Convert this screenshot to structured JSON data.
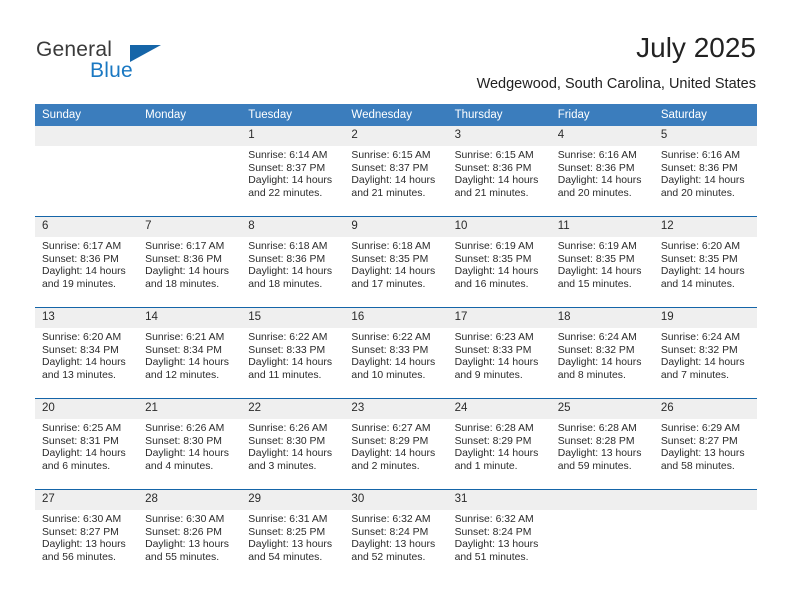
{
  "logo": {
    "word_one": "General",
    "word_two": "Blue",
    "triangle_icon": "triangle-icon",
    "accent_color": "#1a78c2"
  },
  "header": {
    "title": "July 2025",
    "location": "Wedgewood, South Carolina, United States"
  },
  "calendar": {
    "header_bg": "#3b7dbd",
    "separator_color": "#1565a8",
    "daynum_bg": "#efefef",
    "weekday_headers": [
      "Sunday",
      "Monday",
      "Tuesday",
      "Wednesday",
      "Thursday",
      "Friday",
      "Saturday"
    ],
    "weeks": [
      [
        {
          "day": "",
          "sunrise": "",
          "sunset": "",
          "daylight_line1": "",
          "daylight_line2": ""
        },
        {
          "day": "",
          "sunrise": "",
          "sunset": "",
          "daylight_line1": "",
          "daylight_line2": ""
        },
        {
          "day": "1",
          "sunrise": "Sunrise: 6:14 AM",
          "sunset": "Sunset: 8:37 PM",
          "daylight_line1": "Daylight: 14 hours",
          "daylight_line2": "and 22 minutes."
        },
        {
          "day": "2",
          "sunrise": "Sunrise: 6:15 AM",
          "sunset": "Sunset: 8:37 PM",
          "daylight_line1": "Daylight: 14 hours",
          "daylight_line2": "and 21 minutes."
        },
        {
          "day": "3",
          "sunrise": "Sunrise: 6:15 AM",
          "sunset": "Sunset: 8:36 PM",
          "daylight_line1": "Daylight: 14 hours",
          "daylight_line2": "and 21 minutes."
        },
        {
          "day": "4",
          "sunrise": "Sunrise: 6:16 AM",
          "sunset": "Sunset: 8:36 PM",
          "daylight_line1": "Daylight: 14 hours",
          "daylight_line2": "and 20 minutes."
        },
        {
          "day": "5",
          "sunrise": "Sunrise: 6:16 AM",
          "sunset": "Sunset: 8:36 PM",
          "daylight_line1": "Daylight: 14 hours",
          "daylight_line2": "and 20 minutes."
        }
      ],
      [
        {
          "day": "6",
          "sunrise": "Sunrise: 6:17 AM",
          "sunset": "Sunset: 8:36 PM",
          "daylight_line1": "Daylight: 14 hours",
          "daylight_line2": "and 19 minutes."
        },
        {
          "day": "7",
          "sunrise": "Sunrise: 6:17 AM",
          "sunset": "Sunset: 8:36 PM",
          "daylight_line1": "Daylight: 14 hours",
          "daylight_line2": "and 18 minutes."
        },
        {
          "day": "8",
          "sunrise": "Sunrise: 6:18 AM",
          "sunset": "Sunset: 8:36 PM",
          "daylight_line1": "Daylight: 14 hours",
          "daylight_line2": "and 18 minutes."
        },
        {
          "day": "9",
          "sunrise": "Sunrise: 6:18 AM",
          "sunset": "Sunset: 8:35 PM",
          "daylight_line1": "Daylight: 14 hours",
          "daylight_line2": "and 17 minutes."
        },
        {
          "day": "10",
          "sunrise": "Sunrise: 6:19 AM",
          "sunset": "Sunset: 8:35 PM",
          "daylight_line1": "Daylight: 14 hours",
          "daylight_line2": "and 16 minutes."
        },
        {
          "day": "11",
          "sunrise": "Sunrise: 6:19 AM",
          "sunset": "Sunset: 8:35 PM",
          "daylight_line1": "Daylight: 14 hours",
          "daylight_line2": "and 15 minutes."
        },
        {
          "day": "12",
          "sunrise": "Sunrise: 6:20 AM",
          "sunset": "Sunset: 8:35 PM",
          "daylight_line1": "Daylight: 14 hours",
          "daylight_line2": "and 14 minutes."
        }
      ],
      [
        {
          "day": "13",
          "sunrise": "Sunrise: 6:20 AM",
          "sunset": "Sunset: 8:34 PM",
          "daylight_line1": "Daylight: 14 hours",
          "daylight_line2": "and 13 minutes."
        },
        {
          "day": "14",
          "sunrise": "Sunrise: 6:21 AM",
          "sunset": "Sunset: 8:34 PM",
          "daylight_line1": "Daylight: 14 hours",
          "daylight_line2": "and 12 minutes."
        },
        {
          "day": "15",
          "sunrise": "Sunrise: 6:22 AM",
          "sunset": "Sunset: 8:33 PM",
          "daylight_line1": "Daylight: 14 hours",
          "daylight_line2": "and 11 minutes."
        },
        {
          "day": "16",
          "sunrise": "Sunrise: 6:22 AM",
          "sunset": "Sunset: 8:33 PM",
          "daylight_line1": "Daylight: 14 hours",
          "daylight_line2": "and 10 minutes."
        },
        {
          "day": "17",
          "sunrise": "Sunrise: 6:23 AM",
          "sunset": "Sunset: 8:33 PM",
          "daylight_line1": "Daylight: 14 hours",
          "daylight_line2": "and 9 minutes."
        },
        {
          "day": "18",
          "sunrise": "Sunrise: 6:24 AM",
          "sunset": "Sunset: 8:32 PM",
          "daylight_line1": "Daylight: 14 hours",
          "daylight_line2": "and 8 minutes."
        },
        {
          "day": "19",
          "sunrise": "Sunrise: 6:24 AM",
          "sunset": "Sunset: 8:32 PM",
          "daylight_line1": "Daylight: 14 hours",
          "daylight_line2": "and 7 minutes."
        }
      ],
      [
        {
          "day": "20",
          "sunrise": "Sunrise: 6:25 AM",
          "sunset": "Sunset: 8:31 PM",
          "daylight_line1": "Daylight: 14 hours",
          "daylight_line2": "and 6 minutes."
        },
        {
          "day": "21",
          "sunrise": "Sunrise: 6:26 AM",
          "sunset": "Sunset: 8:30 PM",
          "daylight_line1": "Daylight: 14 hours",
          "daylight_line2": "and 4 minutes."
        },
        {
          "day": "22",
          "sunrise": "Sunrise: 6:26 AM",
          "sunset": "Sunset: 8:30 PM",
          "daylight_line1": "Daylight: 14 hours",
          "daylight_line2": "and 3 minutes."
        },
        {
          "day": "23",
          "sunrise": "Sunrise: 6:27 AM",
          "sunset": "Sunset: 8:29 PM",
          "daylight_line1": "Daylight: 14 hours",
          "daylight_line2": "and 2 minutes."
        },
        {
          "day": "24",
          "sunrise": "Sunrise: 6:28 AM",
          "sunset": "Sunset: 8:29 PM",
          "daylight_line1": "Daylight: 14 hours",
          "daylight_line2": "and 1 minute."
        },
        {
          "day": "25",
          "sunrise": "Sunrise: 6:28 AM",
          "sunset": "Sunset: 8:28 PM",
          "daylight_line1": "Daylight: 13 hours",
          "daylight_line2": "and 59 minutes."
        },
        {
          "day": "26",
          "sunrise": "Sunrise: 6:29 AM",
          "sunset": "Sunset: 8:27 PM",
          "daylight_line1": "Daylight: 13 hours",
          "daylight_line2": "and 58 minutes."
        }
      ],
      [
        {
          "day": "27",
          "sunrise": "Sunrise: 6:30 AM",
          "sunset": "Sunset: 8:27 PM",
          "daylight_line1": "Daylight: 13 hours",
          "daylight_line2": "and 56 minutes."
        },
        {
          "day": "28",
          "sunrise": "Sunrise: 6:30 AM",
          "sunset": "Sunset: 8:26 PM",
          "daylight_line1": "Daylight: 13 hours",
          "daylight_line2": "and 55 minutes."
        },
        {
          "day": "29",
          "sunrise": "Sunrise: 6:31 AM",
          "sunset": "Sunset: 8:25 PM",
          "daylight_line1": "Daylight: 13 hours",
          "daylight_line2": "and 54 minutes."
        },
        {
          "day": "30",
          "sunrise": "Sunrise: 6:32 AM",
          "sunset": "Sunset: 8:24 PM",
          "daylight_line1": "Daylight: 13 hours",
          "daylight_line2": "and 52 minutes."
        },
        {
          "day": "31",
          "sunrise": "Sunrise: 6:32 AM",
          "sunset": "Sunset: 8:24 PM",
          "daylight_line1": "Daylight: 13 hours",
          "daylight_line2": "and 51 minutes."
        },
        {
          "day": "",
          "sunrise": "",
          "sunset": "",
          "daylight_line1": "",
          "daylight_line2": ""
        },
        {
          "day": "",
          "sunrise": "",
          "sunset": "",
          "daylight_line1": "",
          "daylight_line2": ""
        }
      ]
    ]
  }
}
